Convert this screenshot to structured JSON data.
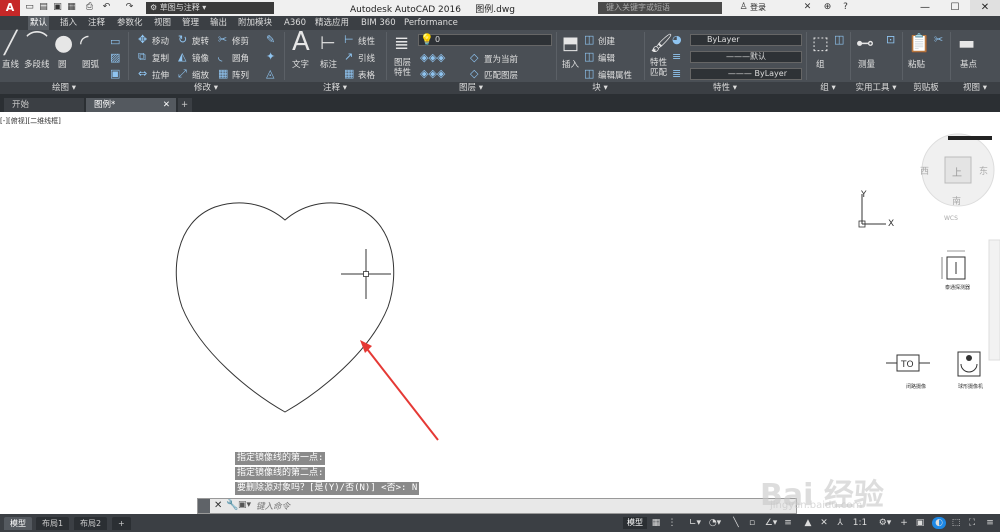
{
  "app": {
    "logo": "A",
    "title": "Autodesk AutoCAD 2016",
    "document": "图例.dwg",
    "workspace": "草图与注释",
    "search_placeholder": "键入关键字或短语",
    "login": "登录"
  },
  "ribbon_tabs": [
    "默认",
    "插入",
    "注释",
    "参数化",
    "视图",
    "管理",
    "输出",
    "附加模块",
    "A360",
    "精选应用",
    "BIM 360",
    "Performance"
  ],
  "ribbon": {
    "draw": [
      "直线",
      "多段线",
      "圆",
      "圆弧"
    ],
    "modify": [
      "移动",
      "旋转",
      "修剪",
      "复制",
      "镜像",
      "圆角",
      "拉伸",
      "缩放",
      "阵列"
    ],
    "annotation": [
      "文字",
      "标注",
      "线性",
      "引线",
      "表格"
    ],
    "layers": {
      "props": "图层\n特性",
      "current_layer": "0",
      "set_current": "置为当前",
      "match_layer": "匹配图层"
    },
    "block": {
      "insert": "插入",
      "create": "创建",
      "edit": "编辑",
      "edit_attr": "编辑属性"
    },
    "properties": {
      "match": "特性\n匹配",
      "color": "ByLayer",
      "linetype": "默认",
      "lineweight": "ByLayer"
    },
    "group": "组",
    "utilities": "测量",
    "clipboard": "粘贴",
    "view": "基点"
  },
  "panel_titles": [
    "绘图",
    "修改",
    "注释",
    "图层",
    "块",
    "特性",
    "组",
    "实用工具",
    "剪贴板",
    "视图"
  ],
  "doc_tabs": [
    "开始",
    "图例*"
  ],
  "viewport_label": "[-][俯视][二维线框]",
  "viewcube": {
    "west": "西",
    "east": "东",
    "south": "南",
    "top": "上",
    "wcs": "WCS"
  },
  "ucs": {
    "x": "X",
    "y": "Y"
  },
  "symbols": {
    "s1": "泰通探测器",
    "s2": "闭路摄像",
    "s3": "球形摄像机"
  },
  "command_history": [
    "指定镜像线的第一点:",
    "指定镜像线的第二点:",
    "要删除源对象吗？[是(Y)/否(N)] <否>: N"
  ],
  "command_placeholder": "键入命令",
  "layout_tabs": [
    "模型",
    "布局1",
    "布局2"
  ],
  "status": {
    "model": "模型",
    "scale": "1:1"
  },
  "watermark": {
    "brand": "Bai 经验",
    "url": "jingyan.baidu.com"
  }
}
